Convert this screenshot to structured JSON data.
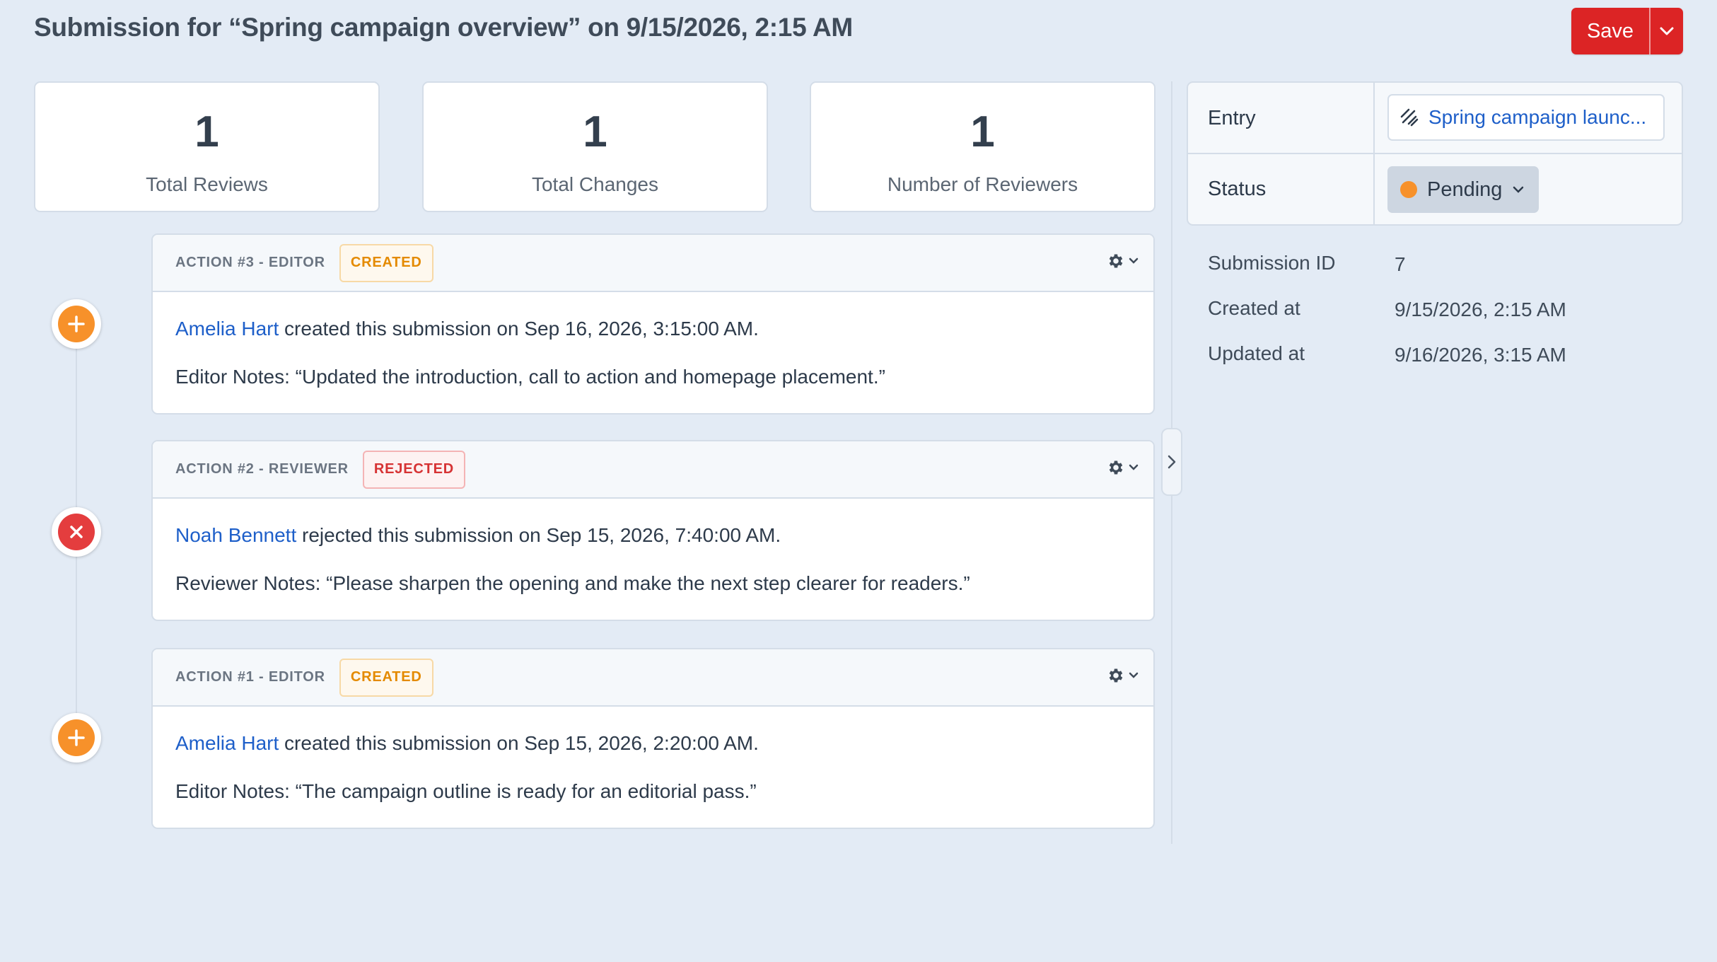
{
  "header": {
    "title": "Submission for “Spring campaign overview” on 9/15/2026, 2:15 AM",
    "save_label": "Save"
  },
  "stats": [
    {
      "value": "1",
      "label": "Total Reviews"
    },
    {
      "value": "1",
      "label": "Total Changes"
    },
    {
      "value": "1",
      "label": "Number of Reviewers"
    }
  ],
  "actions": [
    {
      "title": "ACTION #3 - EDITOR",
      "badge": "CREATED",
      "icon": "plus-icon",
      "user": "Amelia Hart",
      "text": " created this submission on Sep 16, 2026, 3:15:00 AM.",
      "notes": "Editor Notes: “Updated the introduction, call to action and homepage placement.”"
    },
    {
      "title": "ACTION #2 - REVIEWER",
      "badge": "REJECTED",
      "icon": "x-icon",
      "user": "Noah Bennett",
      "text": " rejected this submission on Sep 15, 2026, 7:40:00 AM.",
      "notes": "Reviewer Notes: “Please sharpen the opening and make the next step clearer for readers.”"
    },
    {
      "title": "ACTION #1 - EDITOR",
      "badge": "CREATED",
      "icon": "plus-icon",
      "user": "Amelia Hart",
      "text": " created this submission on Sep 15, 2026, 2:20:00 AM.",
      "notes": "Editor Notes: “The campaign outline is ready for an editorial pass.”"
    }
  ],
  "sidebar": {
    "entry_label": "Entry",
    "entry_value": "Spring campaign launc...",
    "status_label": "Status",
    "status_value": "Pending",
    "submission_id_label": "Submission ID",
    "submission_id_value": "7",
    "created_label": "Created at",
    "created_value": "9/15/2026, 2:15 AM",
    "updated_label": "Updated at",
    "updated_value": "9/16/2026, 3:15 AM"
  },
  "colors": {
    "background": "#e3ebf5",
    "save_button": "#dc2425",
    "created_badge": "#e48a00",
    "rejected_badge": "#d63334",
    "link": "#1e5fc9",
    "pending_dot": "#f7912a"
  }
}
